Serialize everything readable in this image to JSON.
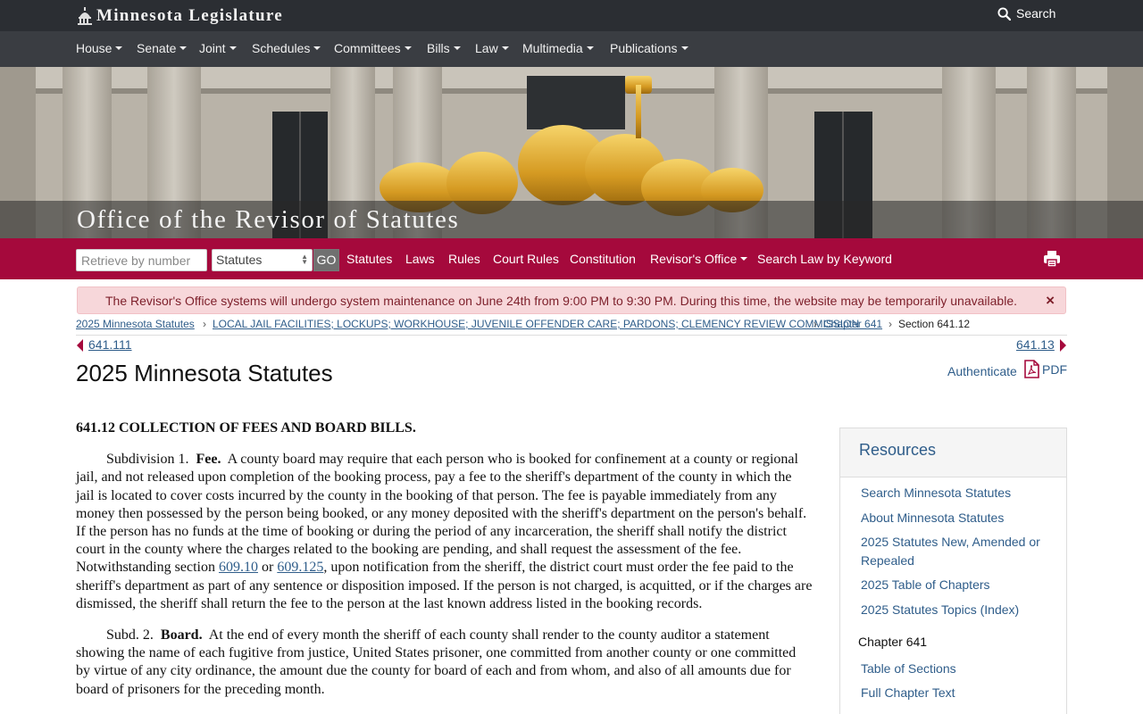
{
  "site": {
    "logo_text": "Minnesota Legislature",
    "search_label": "Search"
  },
  "main_nav": [
    {
      "label": "House"
    },
    {
      "label": "Senate"
    },
    {
      "label": "Joint"
    },
    {
      "label": "Schedules"
    },
    {
      "label": "Committees"
    },
    {
      "label": "Bills"
    },
    {
      "label": "Law"
    },
    {
      "label": "Multimedia"
    },
    {
      "label": "Publications"
    }
  ],
  "hero": {
    "title": "Office of the Revisor of Statutes"
  },
  "revisor_bar": {
    "retrieve_placeholder": "Retrieve by number",
    "select_value": "Statutes",
    "go_label": "GO",
    "links": [
      {
        "label": "Statutes"
      },
      {
        "label": "Laws"
      },
      {
        "label": "Rules"
      },
      {
        "label": "Court Rules"
      },
      {
        "label": "Constitution"
      },
      {
        "label": "Revisor's Office"
      },
      {
        "label": "Search Law by Keyword"
      }
    ]
  },
  "alert": {
    "message": "The Revisor's Office systems will undergo system maintenance on June 24th from 9:00 PM to 9:30 PM. During this time, the website may be temporarily unavailable.",
    "close": "×"
  },
  "breadcrumb": [
    {
      "label": "2025 Minnesota Statutes"
    },
    {
      "label": "LOCAL JAIL FACILITIES; LOCKUPS; WORKHOUSE; JUVENILE OFFENDER CARE; PARDONS; CLEMENCY REVIEW COMMISSION"
    },
    {
      "label": "Chapter 641"
    },
    {
      "label": "Section 641.12"
    }
  ],
  "nav_prev": "641.111",
  "nav_next": "641.13",
  "page_title": "2025 Minnesota Statutes",
  "authenticate_label": "Authenticate",
  "pdf_label": "PDF",
  "statute": {
    "heading": "641.12 COLLECTION OF FEES AND BOARD BILLS.",
    "subd1": {
      "prefix": "Subdivision 1.",
      "title": "Fee.",
      "text_a": "A county board may require that each person who is booked for confinement at a county or regional jail, and not released upon completion of the booking process, pay a fee to the sheriff's department of the county in which the jail is located to cover costs incurred by the county in the booking of that person. The fee is payable immediately from any money then possessed by the person being booked, or any money deposited with the sheriff's department on the person's behalf. If the person has no funds at the time of booking or during the period of any incarceration, the sheriff shall notify the district court in the county where the charges related to the booking are pending, and shall request the assessment of the fee. Notwithstanding section",
      "link1": "609.10",
      "or": "or",
      "link2": "609.125",
      "text_b": ", upon notification from the sheriff, the district court must order the fee paid to the sheriff's department as part of any sentence or disposition imposed. If the person is not charged, is acquitted, or if the charges are dismissed, the sheriff shall return the fee to the person at the last known address listed in the booking records."
    },
    "subd2": {
      "prefix": "Subd. 2.",
      "title": "Board.",
      "text": "At the end of every month the sheriff of each county shall render to the county auditor a statement showing the name of each fugitive from justice, United States prisoner, one committed from another county or one committed by virtue of any city ordinance, the amount due the county for board of each and from whom, and also of all amounts due for board of prisoners for the preceding month."
    }
  },
  "resources": {
    "heading": "Resources",
    "links": [
      {
        "label": "Search Minnesota Statutes"
      },
      {
        "label": "About Minnesota Statutes"
      },
      {
        "label": "2025 Statutes New, Amended or Repealed"
      },
      {
        "label": "2025 Table of Chapters"
      },
      {
        "label": "2025 Statutes Topics (Index)"
      }
    ],
    "chapter_heading": "Chapter 641",
    "chapter_links": [
      {
        "label": "Table of Sections"
      },
      {
        "label": "Full Chapter Text"
      }
    ]
  },
  "colors": {
    "topbar": "#2b2e33",
    "nav": "#3a3d42",
    "revisor_red": "#a5093c",
    "link": "#2f5d8a",
    "alert_bg": "#f7d7da"
  },
  "icons": [
    "capitol-dome-icon",
    "search-icon",
    "caret-down-icon",
    "print-icon",
    "close-icon",
    "chevron-right-icon",
    "arrow-left-icon",
    "arrow-right-icon",
    "pdf-icon"
  ]
}
